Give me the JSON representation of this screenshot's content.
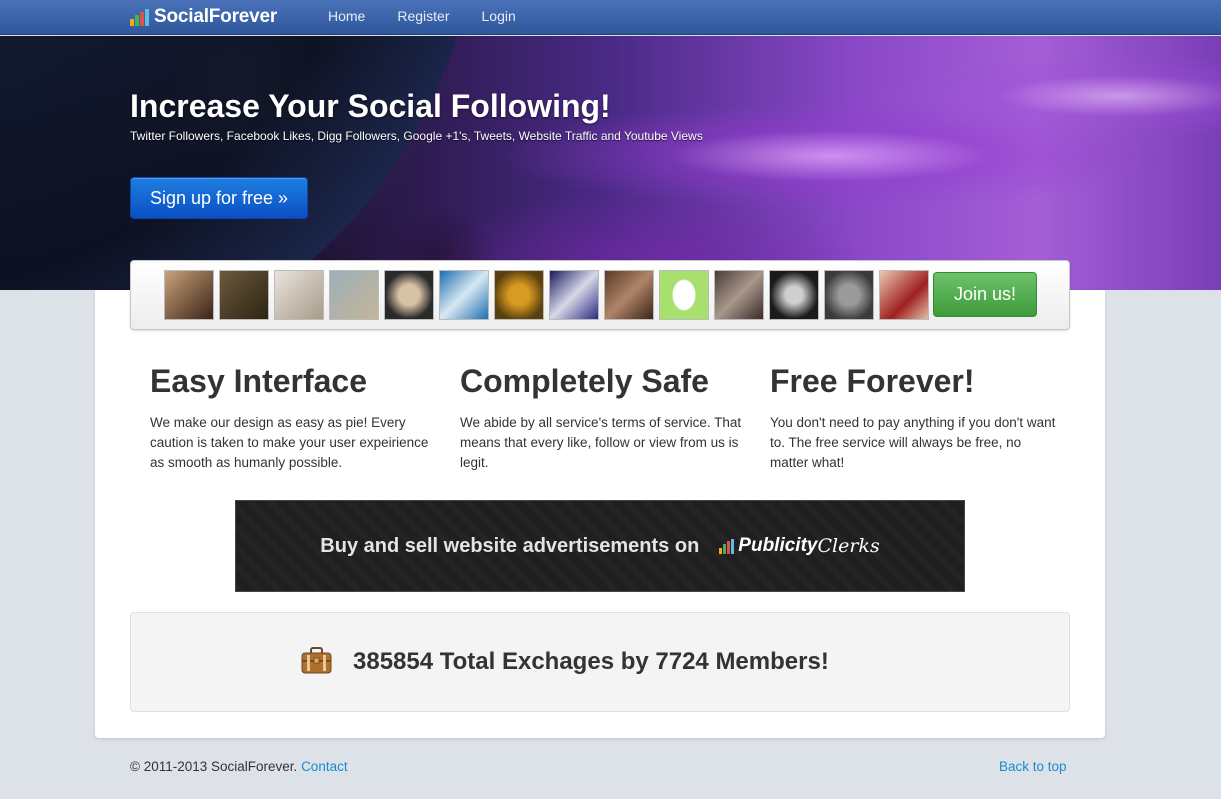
{
  "navbar": {
    "brand": "SocialForever",
    "links": [
      "Home",
      "Register",
      "Login"
    ]
  },
  "hero": {
    "title": "Increase Your Social Following!",
    "subtitle": "Twitter Followers, Facebook Likes, Digg Followers, Google +1's, Tweets, Website Traffic and Youtube Views",
    "signup_label": "Sign up for free »"
  },
  "avatars": {
    "count": 14,
    "join_label": "Join us!"
  },
  "features": [
    {
      "title": "Easy Interface",
      "text": "We make our design as easy as pie! Every caution is taken to make your user expeirience as smooth as humanly possible."
    },
    {
      "title": "Completely Safe",
      "text": "We abide by all service's terms of service. That means that every like, follow or view from us is legit."
    },
    {
      "title": "Free Forever!",
      "text": "You don't need to pay anything if you don't want to. The free service will always be free, no matter what!"
    }
  ],
  "ad": {
    "text": "Buy and sell website advertisements on",
    "logo_bold": "Publicity",
    "logo_script": "Clerks"
  },
  "stats": {
    "text": "385854 Total Exchages by 7724 Members!"
  },
  "footer": {
    "copyright": "© 2011-2013 SocialForever.",
    "contact": "Contact",
    "back_to_top": "Back to top"
  },
  "colors": {
    "nav_bg": "#3a62aa",
    "primary_button": "#1366d6",
    "success_button": "#52ad50",
    "link": "#1a8ad0"
  }
}
